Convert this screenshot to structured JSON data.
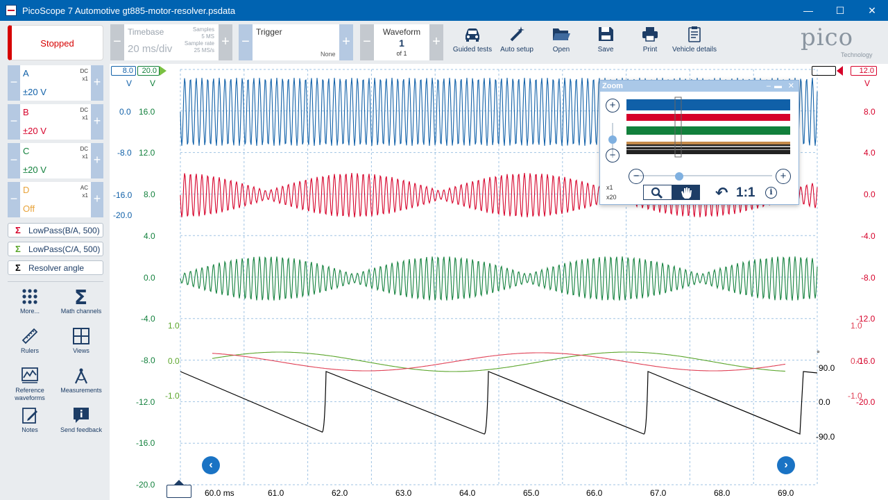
{
  "window": {
    "title": "PicoScope 7 Automotive gt885-motor-resolver.psdata",
    "minimize": "—",
    "maximize": "☐",
    "close": "✕"
  },
  "toolbar": {
    "run_state": "Stopped",
    "timebase": {
      "label": "Timebase",
      "value": "20 ms/div",
      "samples_label": "Samples",
      "samples_value": "5 MS",
      "rate_label": "Sample rate",
      "rate_value": "25 MS/s"
    },
    "trigger": {
      "label": "Trigger",
      "mode": "None"
    },
    "waveform": {
      "label": "Waveform",
      "current": "1",
      "of": "of 1"
    },
    "tools": [
      {
        "label": "Guided tests",
        "icon": "car-icon"
      },
      {
        "label": "Auto setup",
        "icon": "wand-icon"
      },
      {
        "label": "Open",
        "icon": "folder-icon"
      },
      {
        "label": "Save",
        "icon": "save-icon"
      },
      {
        "label": "Print",
        "icon": "printer-icon"
      },
      {
        "label": "Vehicle details",
        "icon": "clipboard-icon"
      }
    ],
    "logo": "pico",
    "logo_sub": "Technology"
  },
  "channels": [
    {
      "letter": "A",
      "coupling": "DC",
      "probe": "x1",
      "range": "±20 V",
      "color": "#1060a8"
    },
    {
      "letter": "B",
      "coupling": "DC",
      "probe": "x1",
      "range": "±20 V",
      "color": "#d60029"
    },
    {
      "letter": "C",
      "coupling": "DC",
      "probe": "x1",
      "range": "±20 V",
      "color": "#12803c"
    },
    {
      "letter": "D",
      "coupling": "AC",
      "probe": "x1",
      "range": "Off",
      "color": "#e8a33a"
    }
  ],
  "math_channels": [
    {
      "label": "LowPass(B/A, 500)",
      "color": "#d60029"
    },
    {
      "label": "LowPass(C/A, 500)",
      "color": "#5aa52a"
    },
    {
      "label": "Resolver angle",
      "color": "#000000"
    }
  ],
  "side_tools": [
    {
      "label": "More...",
      "icon": "grid-dots-icon"
    },
    {
      "label": "Math channels",
      "icon": "sigma-icon"
    },
    {
      "label": "Rulers",
      "icon": "ruler-icon"
    },
    {
      "label": "Views",
      "icon": "views-icon"
    },
    {
      "label": "Reference waveforms",
      "icon": "reference-waveform-icon"
    },
    {
      "label": "Measurements",
      "icon": "compass-icon"
    },
    {
      "label": "Notes",
      "icon": "notes-icon"
    },
    {
      "label": "Send feedback",
      "icon": "feedback-icon"
    }
  ],
  "axes": {
    "a_scale_top": "8.0",
    "c_scale_top": "20.0",
    "a_unit": "V",
    "c_unit": "V",
    "a_ticks": [
      "0.0",
      "-8.0",
      "-16.0"
    ],
    "a_bottom": "-20.0",
    "c_ticks": [
      "16.0",
      "12.0",
      "8.0",
      "4.0",
      "0.0",
      "-4.0",
      "-8.0",
      "-12.0",
      "-16.0",
      "-20.0"
    ],
    "green_math_ticks": [
      "1.0",
      "0.0",
      "-1.0"
    ],
    "b_scale_top": "12.0",
    "b_unit": "V",
    "b_ticks": [
      "8.0",
      "4.0",
      "0.0",
      "-4.0",
      "-8.0",
      "-12.0",
      "-16.0",
      "-20.0"
    ],
    "red_math_ticks": [
      "1.0",
      "0.0",
      "-1.0"
    ],
    "angle_unit": "°",
    "angle_ticks": [
      "90.0",
      "0.0",
      "-90.0"
    ],
    "time_ticks": [
      "60.0 ms",
      "61.0",
      "62.0",
      "63.0",
      "64.0",
      "65.0",
      "66.0",
      "67.0",
      "68.0",
      "69.0"
    ]
  },
  "zoom": {
    "title": "Zoom",
    "zoom_x1": "x1",
    "zoom_x20": "x20",
    "reset_label": "1:1"
  },
  "colors": {
    "accent": "#0063b1",
    "channel_a": "#1060a8",
    "channel_b": "#d60029",
    "channel_c": "#12803c",
    "math_green": "#5aa52a",
    "grid": "#9fc3e3"
  }
}
